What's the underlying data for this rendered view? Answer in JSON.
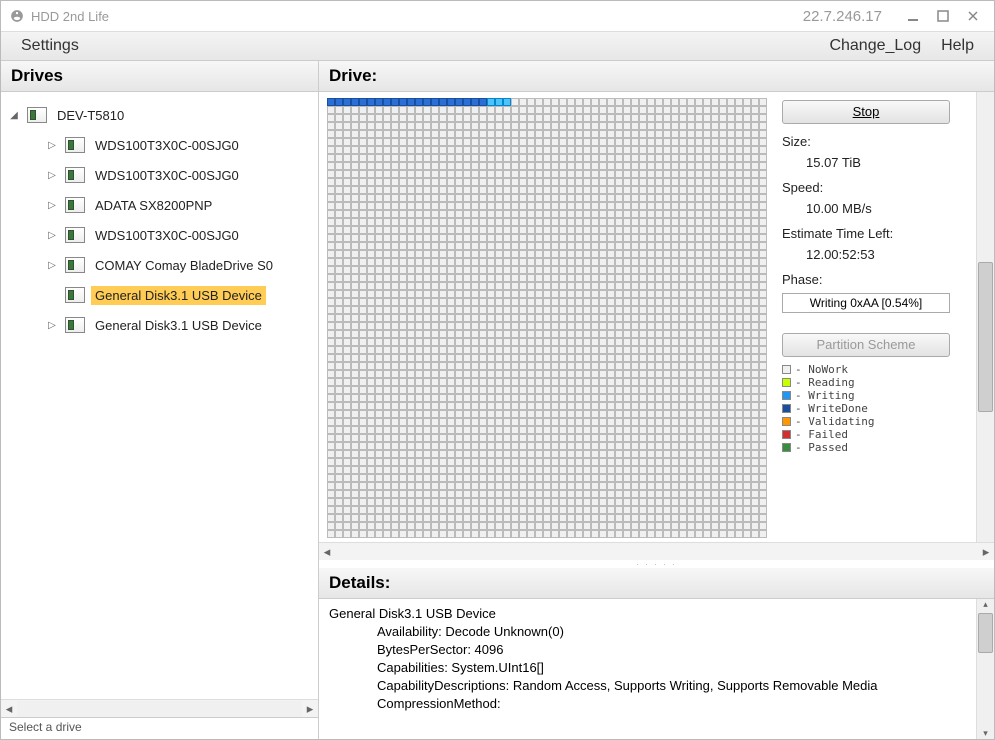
{
  "window": {
    "title": "HDD 2nd Life",
    "version": "22.7.246.17"
  },
  "menu": {
    "settings": "Settings",
    "changelog": "Change_Log",
    "help": "Help"
  },
  "panels": {
    "drives": "Drives",
    "drive": "Drive:",
    "details": "Details:"
  },
  "tree": {
    "root": "DEV-T5810",
    "items": [
      {
        "label": "WDS100T3X0C-00SJG0"
      },
      {
        "label": "WDS100T3X0C-00SJG0"
      },
      {
        "label": "ADATA SX8200PNP"
      },
      {
        "label": "WDS100T3X0C-00SJG0"
      },
      {
        "label": "COMAY Comay BladeDrive S0"
      },
      {
        "label": "General Disk3.1 USB Device",
        "selected": true
      },
      {
        "label": "General Disk3.1 USB Device"
      }
    ]
  },
  "status": {
    "text": "Select a drive"
  },
  "controls": {
    "stop": "Stop",
    "size_label": "Size:",
    "size_value": "15.07 TiB",
    "speed_label": "Speed:",
    "speed_value": "10.00 MB/s",
    "eta_label": "Estimate Time Left:",
    "eta_value": "12.00:52:53",
    "phase_label": "Phase:",
    "phase_value": "Writing 0xAA [0.54%]",
    "partition": "Partition Scheme"
  },
  "legend": [
    {
      "color": "#f0f0f0",
      "label": "NoWork"
    },
    {
      "color": "#c6ff00",
      "label": "Reading"
    },
    {
      "color": "#2196f3",
      "label": "Writing"
    },
    {
      "color": "#1a4fa0",
      "label": "WriteDone"
    },
    {
      "color": "#ff9800",
      "label": "Validating"
    },
    {
      "color": "#d32f2f",
      "label": "Failed"
    },
    {
      "color": "#388e3c",
      "label": "Passed"
    }
  ],
  "details": {
    "title": "General Disk3.1 USB Device",
    "lines": [
      "Availability: Decode Unknown(0)",
      "BytesPerSector: 4096",
      "Capabilities: System.UInt16[]",
      "CapabilityDescriptions: Random Access, Supports Writing, Supports Removable Media",
      "CompressionMethod:"
    ]
  },
  "grid": {
    "cols": 55,
    "rows": 55,
    "done": 20,
    "writing": 3
  }
}
